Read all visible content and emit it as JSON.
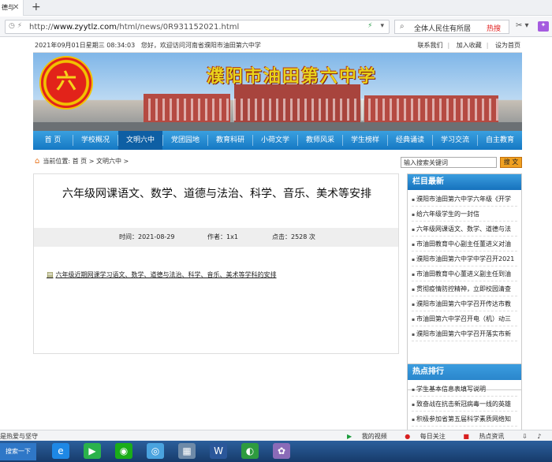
{
  "browser": {
    "tab_title": "德与",
    "url_prefix": "http://",
    "url_host": "www.zyytlz.com",
    "url_path": "/html/news/0R931152021.html",
    "search_text": "全体人民住有所居",
    "hot_label": "热搜"
  },
  "site": {
    "date": "2021年09月01日星期三  08:34:03",
    "welcome": "您好，欢迎访问河南省濮阳市油田第六中学",
    "top_links": [
      "联系我们",
      "加入收藏",
      "设为首页"
    ],
    "title": "濮阳市油田第六中学",
    "logo_char": "六"
  },
  "nav": [
    "首 页",
    "学校概况",
    "文明六中",
    "党团园地",
    "教育科研",
    "小荷文学",
    "教师风采",
    "学生榜样",
    "经典诵读",
    "学习交流",
    "自主教育"
  ],
  "breadcrumb": {
    "label": "当前位置:",
    "home": "首 页",
    "sep1": ">",
    "section": "文明六中",
    "sep2": ">"
  },
  "search": {
    "placeholder": "输入搜索关键词",
    "button": "搜 文"
  },
  "article": {
    "title": "六年级网课语文、数学、道德与法治、科学、音乐、美术等安排",
    "time": "时间：2021-08-29",
    "author": "作者：1x1",
    "clicks": "点击：2528 次",
    "attachment": "六年级近期网课学习语文、数学、道德与法治、科学、音乐、美术等学科的安排"
  },
  "latest": {
    "heading": "栏目最新",
    "items": [
      "濮阳市油田第六中学六年级《开学",
      "给六年级学生的一封信",
      "六年级网课语文、数学、道德与法",
      "市油田教育中心副主任董进义对油",
      "濮阳市油田第六中学中学召开2021",
      "市油田教育中心董进义副主任到油",
      "贯彻疫情防控精神，立即校园清查",
      "濮阳市油田第六中学召开传达市教",
      "市油田第六中学召开电（机）动三",
      "濮阳市油田第六中学召开落实市新"
    ]
  },
  "hot": {
    "heading": "热点排行",
    "items": [
      "学生基本信息表填写说明",
      "致奋战在抗击新冠病毒一线的英雄",
      "积极参加省第五届科学素质网络知"
    ]
  },
  "status": {
    "left": "是热爱与坚守",
    "video": "我的视频",
    "follow": "每日关注",
    "hotnews": "热点资讯"
  },
  "taskbar": {
    "start": "搜索一下"
  }
}
